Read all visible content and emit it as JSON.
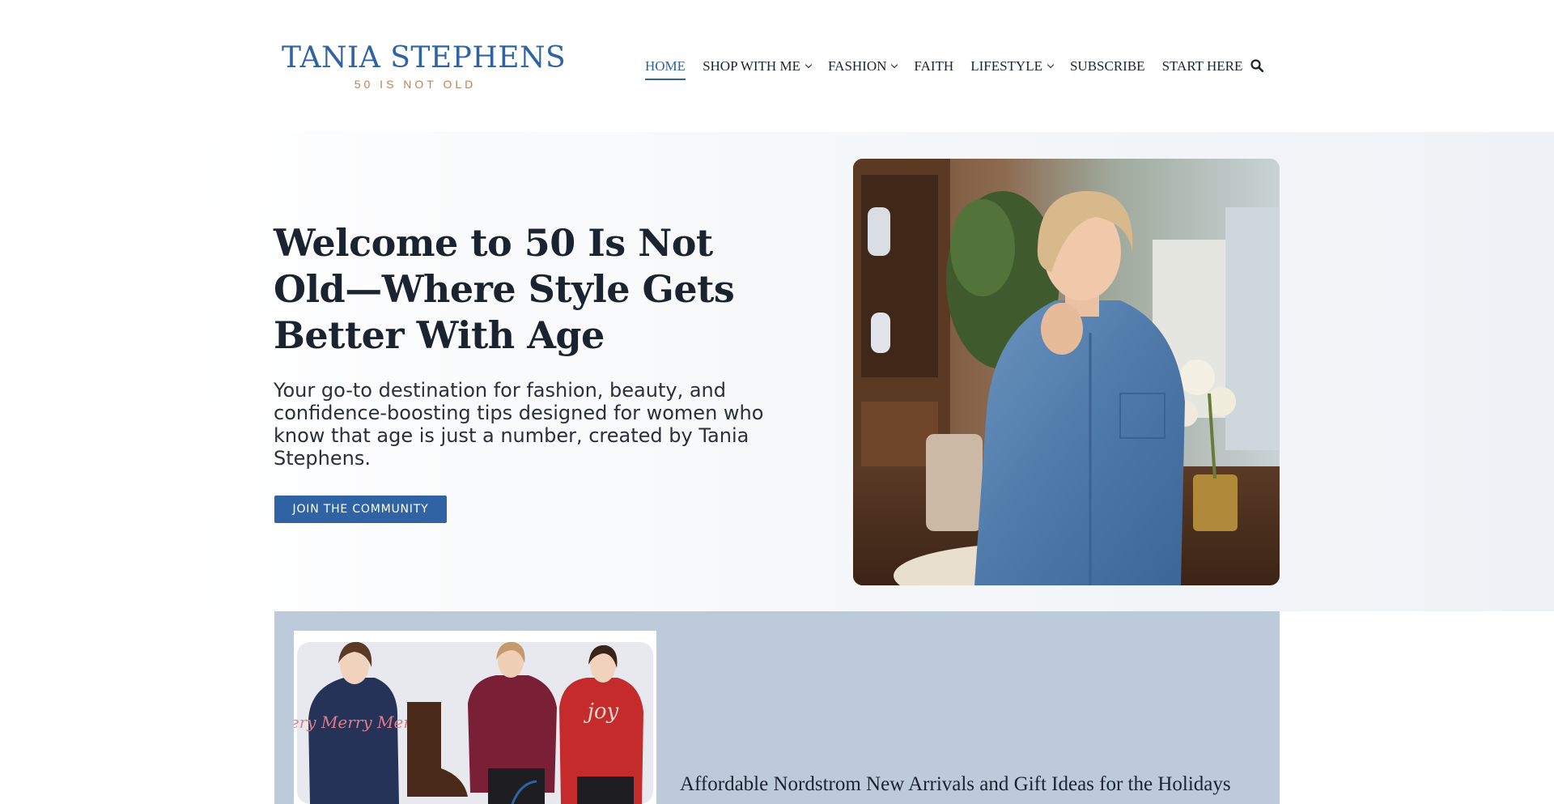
{
  "logo": {
    "title": "TANIA STEPHENS",
    "subtitle": "50 IS NOT OLD"
  },
  "nav": {
    "items": [
      {
        "label": "HOME",
        "active": true,
        "dropdown": false
      },
      {
        "label": "SHOP WITH ME",
        "active": false,
        "dropdown": true
      },
      {
        "label": "FASHION",
        "active": false,
        "dropdown": true
      },
      {
        "label": "FAITH",
        "active": false,
        "dropdown": false
      },
      {
        "label": "LIFESTYLE",
        "active": false,
        "dropdown": true
      },
      {
        "label": "SUBSCRIBE",
        "active": false,
        "dropdown": false
      },
      {
        "label": "START HERE",
        "active": false,
        "dropdown": false
      }
    ],
    "search_icon": "search-icon"
  },
  "hero": {
    "title": "Welcome to 50 Is Not Old—Where Style Gets Better With Age",
    "subtitle": "Your go-to destination for fashion, beauty, and confidence-boosting tips designed for women who know that age is just a number, created by Tania Stephens.",
    "cta_label": "JOIN THE COMMUNITY"
  },
  "featured": {
    "title": "Affordable Nordstrom New Arrivals and Gift Ideas for the Holidays",
    "sweater_text_1": "Very Merry Merry",
    "sweater_text_2": "joy"
  },
  "colors": {
    "brand": "#2f63a3",
    "logo_sub": "#b8835a",
    "featured_bg": "#bccad9",
    "text": "#1c2330"
  }
}
